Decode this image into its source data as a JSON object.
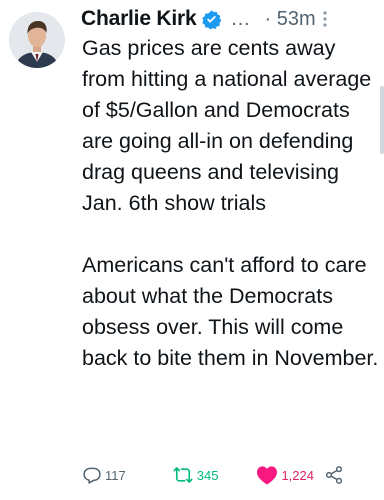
{
  "author": {
    "display_name": "Charlie Kirk",
    "verified": true,
    "ellipsis": "…",
    "timestamp": "· 53m"
  },
  "tweet": {
    "paragraphs": [
      "Gas prices are cents away from hitting a national average of $5/Gallon and Democrats are going all-in on defending drag queens and televising Jan. 6th show trials",
      "Americans can't afford to care about what the Democrats obsess over. This will come back to bite them in November."
    ]
  },
  "actions": {
    "reply_count": "117",
    "retweet_count": "345",
    "like_count": "1,224"
  },
  "colors": {
    "verified": "#1d9bf0",
    "retweet": "#00ba7c",
    "like": "#f91880",
    "secondary_text": "#536471"
  },
  "icons": [
    "verified-badge-icon",
    "more-options-icon",
    "reply-icon",
    "retweet-icon",
    "like-icon",
    "share-icon"
  ]
}
